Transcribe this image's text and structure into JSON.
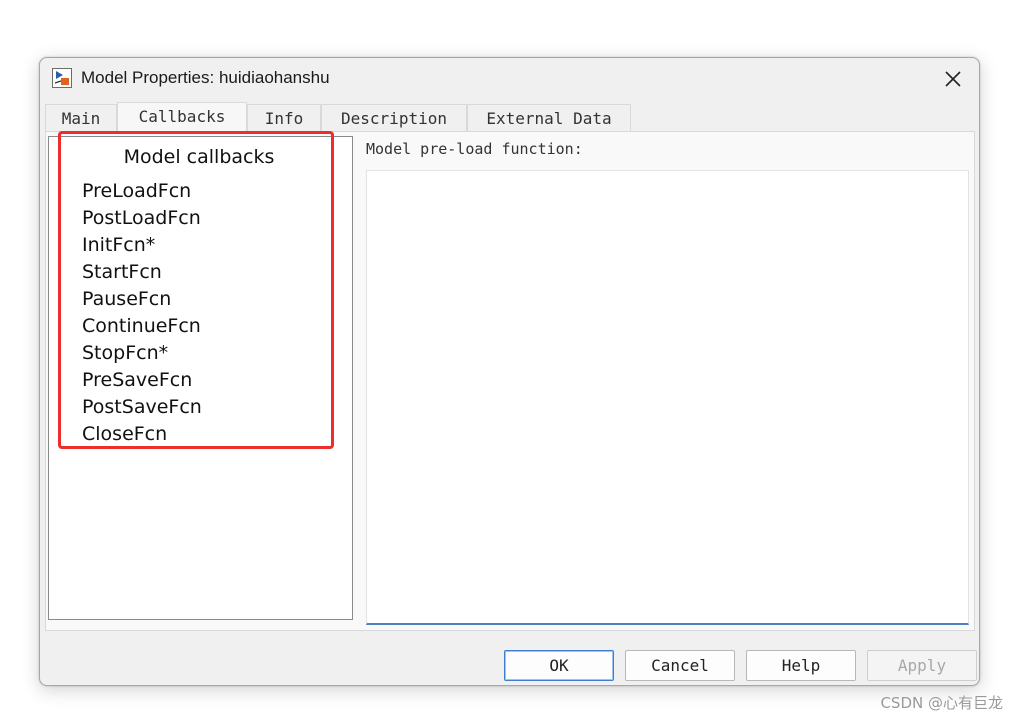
{
  "window": {
    "title": "Model Properties: huidiaohanshu"
  },
  "tabs": [
    {
      "label": "Main",
      "active": false
    },
    {
      "label": "Callbacks",
      "active": true
    },
    {
      "label": "Info",
      "active": false
    },
    {
      "label": "Description",
      "active": false
    },
    {
      "label": "External Data",
      "active": false
    }
  ],
  "callbacks": {
    "header": "Model callbacks",
    "items": [
      "PreLoadFcn",
      "PostLoadFcn",
      "InitFcn*",
      "StartFcn",
      "PauseFcn",
      "ContinueFcn",
      "StopFcn*",
      "PreSaveFcn",
      "PostSaveFcn",
      "CloseFcn"
    ]
  },
  "editor": {
    "label": "Model pre-load function:",
    "value": ""
  },
  "buttons": {
    "ok": "OK",
    "cancel": "Cancel",
    "help": "Help",
    "apply": "Apply"
  },
  "watermark": "CSDN @心有巨龙",
  "colors": {
    "highlight": "#ee2d2d",
    "focus_border": "#4e7fc1"
  }
}
